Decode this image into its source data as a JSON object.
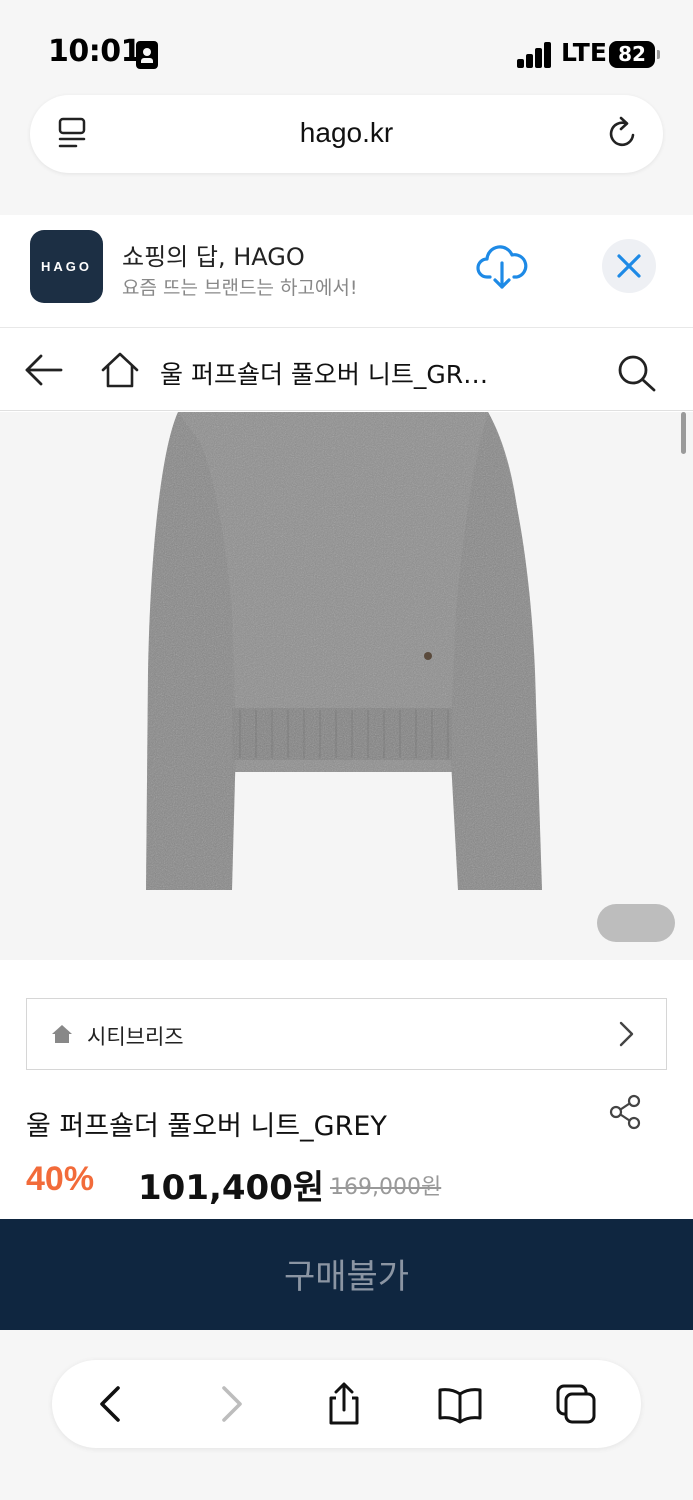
{
  "status_bar": {
    "time": "10:01",
    "network": "LTE",
    "battery": "82"
  },
  "browser": {
    "url": "hago.kr"
  },
  "app_banner": {
    "logo_text": "HAGO",
    "name": "쇼핑의 답, HAGO",
    "description": "요즘 뜨는 브랜드는 하고에서!"
  },
  "nav": {
    "title": "울 퍼프숄더 풀오버 니트_GR…"
  },
  "brand": {
    "name": "시티브리즈"
  },
  "product": {
    "title": "울 퍼프숄더 풀오버 니트_GREY",
    "discount": "40%",
    "price": "101,400원",
    "original_price": "169,000원",
    "discount_color": "#f26b3a"
  },
  "buy_button": {
    "label": "구매불가",
    "bg_color": "#0f2640"
  },
  "toolbar": {
    "icons": [
      "back-icon",
      "forward-icon",
      "share-icon",
      "bookmarks-icon",
      "tabs-icon"
    ]
  }
}
